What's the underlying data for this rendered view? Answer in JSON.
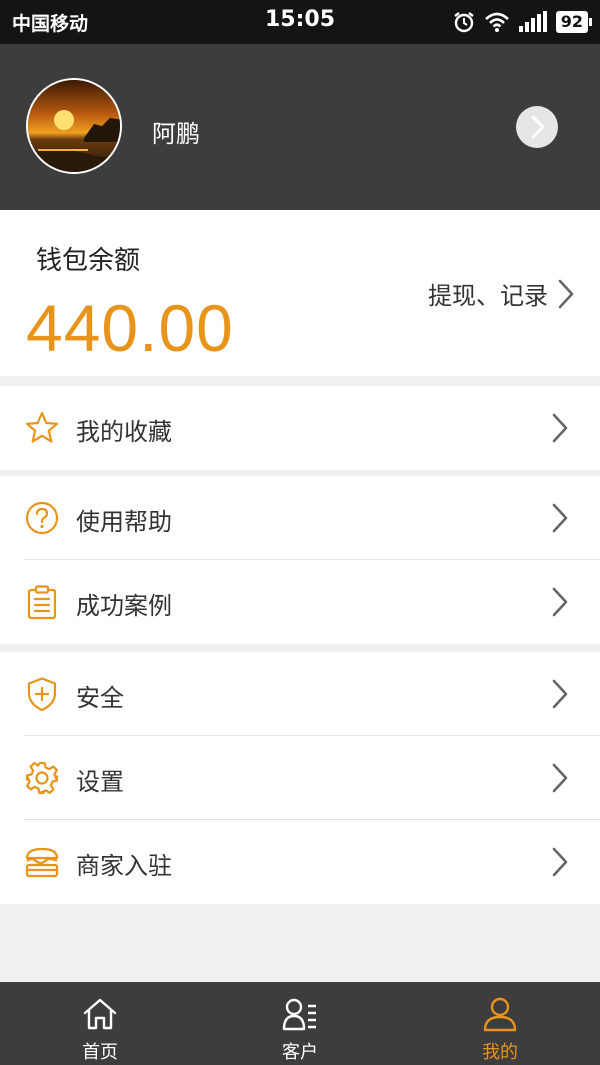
{
  "status_bar": {
    "carrier": "中国移动",
    "time": "15:05",
    "battery": "92"
  },
  "profile": {
    "name": "阿鹏"
  },
  "wallet": {
    "title": "钱包余额",
    "amount": "440.00",
    "link_label": "提现、记录"
  },
  "menu": {
    "favorites": "我的收藏",
    "help": "使用帮助",
    "cases": "成功案例",
    "security": "安全",
    "settings": "设置",
    "merchant": "商家入驻"
  },
  "tab_bar": {
    "home": "首页",
    "clients": "客户",
    "mine": "我的"
  },
  "colors": {
    "accent": "#e8941a",
    "header_bg": "#3d3d3d",
    "status_bg": "#141414",
    "page_bg": "#f0f0f0"
  },
  "icons": [
    "alarm-icon",
    "wifi-icon",
    "signal-icon",
    "battery-icon",
    "chevron-right-icon",
    "star-icon",
    "question-icon",
    "clipboard-icon",
    "shield-icon",
    "gear-icon",
    "shop-icon",
    "home-icon",
    "contacts-icon",
    "user-icon"
  ]
}
